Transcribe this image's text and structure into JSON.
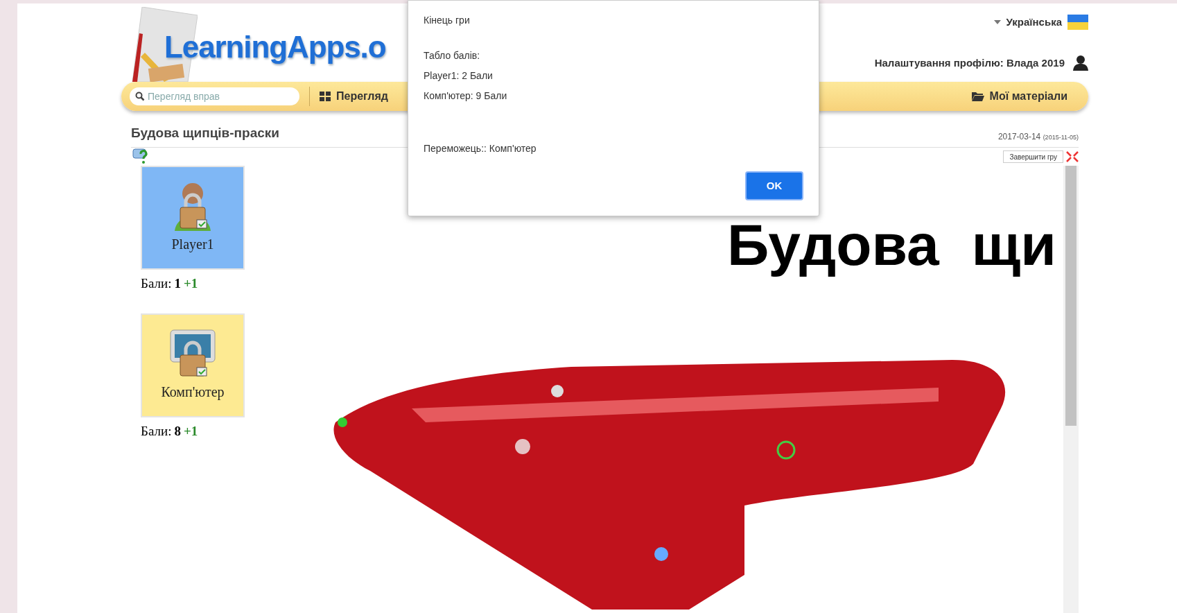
{
  "header": {
    "logo": "LearningApps.o",
    "language": "Українська",
    "profile": "Налаштування профілю: Влада 2019"
  },
  "nav": {
    "search_placeholder": "Перегляд вправ",
    "items": [
      {
        "label": "Перегляд",
        "kind": "grid"
      },
      {
        "label": "Мої матеріали",
        "kind": "folder"
      }
    ]
  },
  "app": {
    "title": "Будова щипців-праски",
    "date": "2017-03-14",
    "created": "(2015-11-05)"
  },
  "players": [
    {
      "name": "Player1",
      "kind": "person",
      "active": true,
      "score_label": "Бали:",
      "score": "1",
      "bonus": "+1"
    },
    {
      "name": "Комп'ютер",
      "kind": "computer",
      "active": false,
      "score_label": "Бали:",
      "score": "8",
      "bonus": "+1"
    }
  ],
  "game": {
    "end_button": "Завершити гру",
    "heading": "Будова  щи"
  },
  "dialog": {
    "title": "Кінець гри",
    "lines": [
      "Табло балів:",
      "Player1: 2 Бали",
      "Комп'ютер: 9 Бали"
    ],
    "result": "Переможець:: Комп'ютер",
    "button": "OK"
  }
}
